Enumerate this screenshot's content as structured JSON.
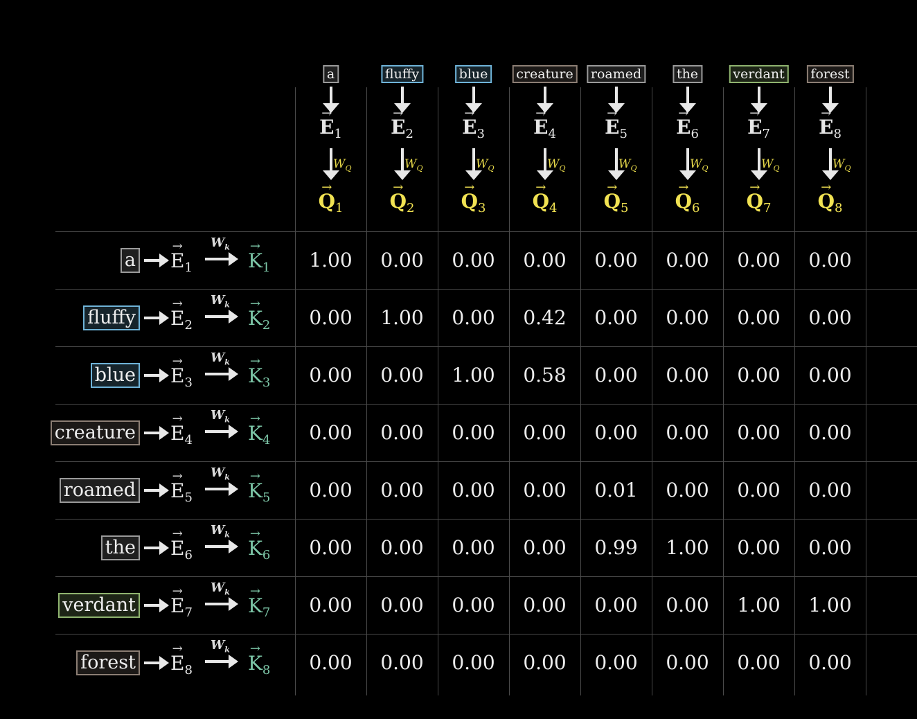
{
  "columns": [
    {
      "word": "a",
      "color": "#9a9a9a",
      "e_label": "E",
      "e_sub": "1",
      "q_label": "Q",
      "q_sub": "1"
    },
    {
      "word": "fluffy",
      "color": "#6fb3d8",
      "e_label": "E",
      "e_sub": "2",
      "q_label": "Q",
      "q_sub": "2"
    },
    {
      "word": "blue",
      "color": "#6fb3d8",
      "e_label": "E",
      "e_sub": "3",
      "q_label": "Q",
      "q_sub": "3"
    },
    {
      "word": "creature",
      "color": "#8c7e74",
      "e_label": "E",
      "e_sub": "4",
      "q_label": "Q",
      "q_sub": "4"
    },
    {
      "word": "roamed",
      "color": "#9a9a9a",
      "e_label": "E",
      "e_sub": "5",
      "q_label": "Q",
      "q_sub": "5"
    },
    {
      "word": "the",
      "color": "#9a9a9a",
      "e_label": "E",
      "e_sub": "6",
      "q_label": "Q",
      "q_sub": "6"
    },
    {
      "word": "verdant",
      "color": "#8fb36f",
      "e_label": "E",
      "e_sub": "7",
      "q_label": "Q",
      "q_sub": "7"
    },
    {
      "word": "forest",
      "color": "#8c7e74",
      "e_label": "E",
      "e_sub": "8",
      "q_label": "Q",
      "q_sub": "8"
    }
  ],
  "wq": {
    "label": "W",
    "sub": "Q"
  },
  "wk": {
    "label": "W",
    "sub": "k"
  },
  "rows": [
    {
      "word": "a",
      "color": "#9a9a9a",
      "e_label": "E",
      "e_sub": "1",
      "k_label": "K",
      "k_sub": "1",
      "values": [
        "1.00",
        "0.00",
        "0.00",
        "0.00",
        "0.00",
        "0.00",
        "0.00",
        "0.00"
      ]
    },
    {
      "word": "fluffy",
      "color": "#6fb3d8",
      "e_label": "E",
      "e_sub": "2",
      "k_label": "K",
      "k_sub": "2",
      "values": [
        "0.00",
        "1.00",
        "0.00",
        "0.42",
        "0.00",
        "0.00",
        "0.00",
        "0.00"
      ]
    },
    {
      "word": "blue",
      "color": "#6fb3d8",
      "e_label": "E",
      "e_sub": "3",
      "k_label": "K",
      "k_sub": "3",
      "values": [
        "0.00",
        "0.00",
        "1.00",
        "0.58",
        "0.00",
        "0.00",
        "0.00",
        "0.00"
      ]
    },
    {
      "word": "creature",
      "color": "#8c7e74",
      "e_label": "E",
      "e_sub": "4",
      "k_label": "K",
      "k_sub": "4",
      "values": [
        "0.00",
        "0.00",
        "0.00",
        "0.00",
        "0.00",
        "0.00",
        "0.00",
        "0.00"
      ]
    },
    {
      "word": "roamed",
      "color": "#9a9a9a",
      "e_label": "E",
      "e_sub": "5",
      "k_label": "K",
      "k_sub": "5",
      "values": [
        "0.00",
        "0.00",
        "0.00",
        "0.00",
        "0.01",
        "0.00",
        "0.00",
        "0.00"
      ]
    },
    {
      "word": "the",
      "color": "#9a9a9a",
      "e_label": "E",
      "e_sub": "6",
      "k_label": "K",
      "k_sub": "6",
      "values": [
        "0.00",
        "0.00",
        "0.00",
        "0.00",
        "0.99",
        "1.00",
        "0.00",
        "0.00"
      ]
    },
    {
      "word": "verdant",
      "color": "#8fb36f",
      "e_label": "E",
      "e_sub": "7",
      "k_label": "K",
      "k_sub": "7",
      "values": [
        "0.00",
        "0.00",
        "0.00",
        "0.00",
        "0.00",
        "0.00",
        "1.00",
        "1.00"
      ]
    },
    {
      "word": "forest",
      "color": "#8c7e74",
      "e_label": "E",
      "e_sub": "8",
      "k_label": "K",
      "k_sub": "8",
      "values": [
        "0.00",
        "0.00",
        "0.00",
        "0.00",
        "0.00",
        "0.00",
        "0.00",
        "0.00"
      ]
    }
  ]
}
